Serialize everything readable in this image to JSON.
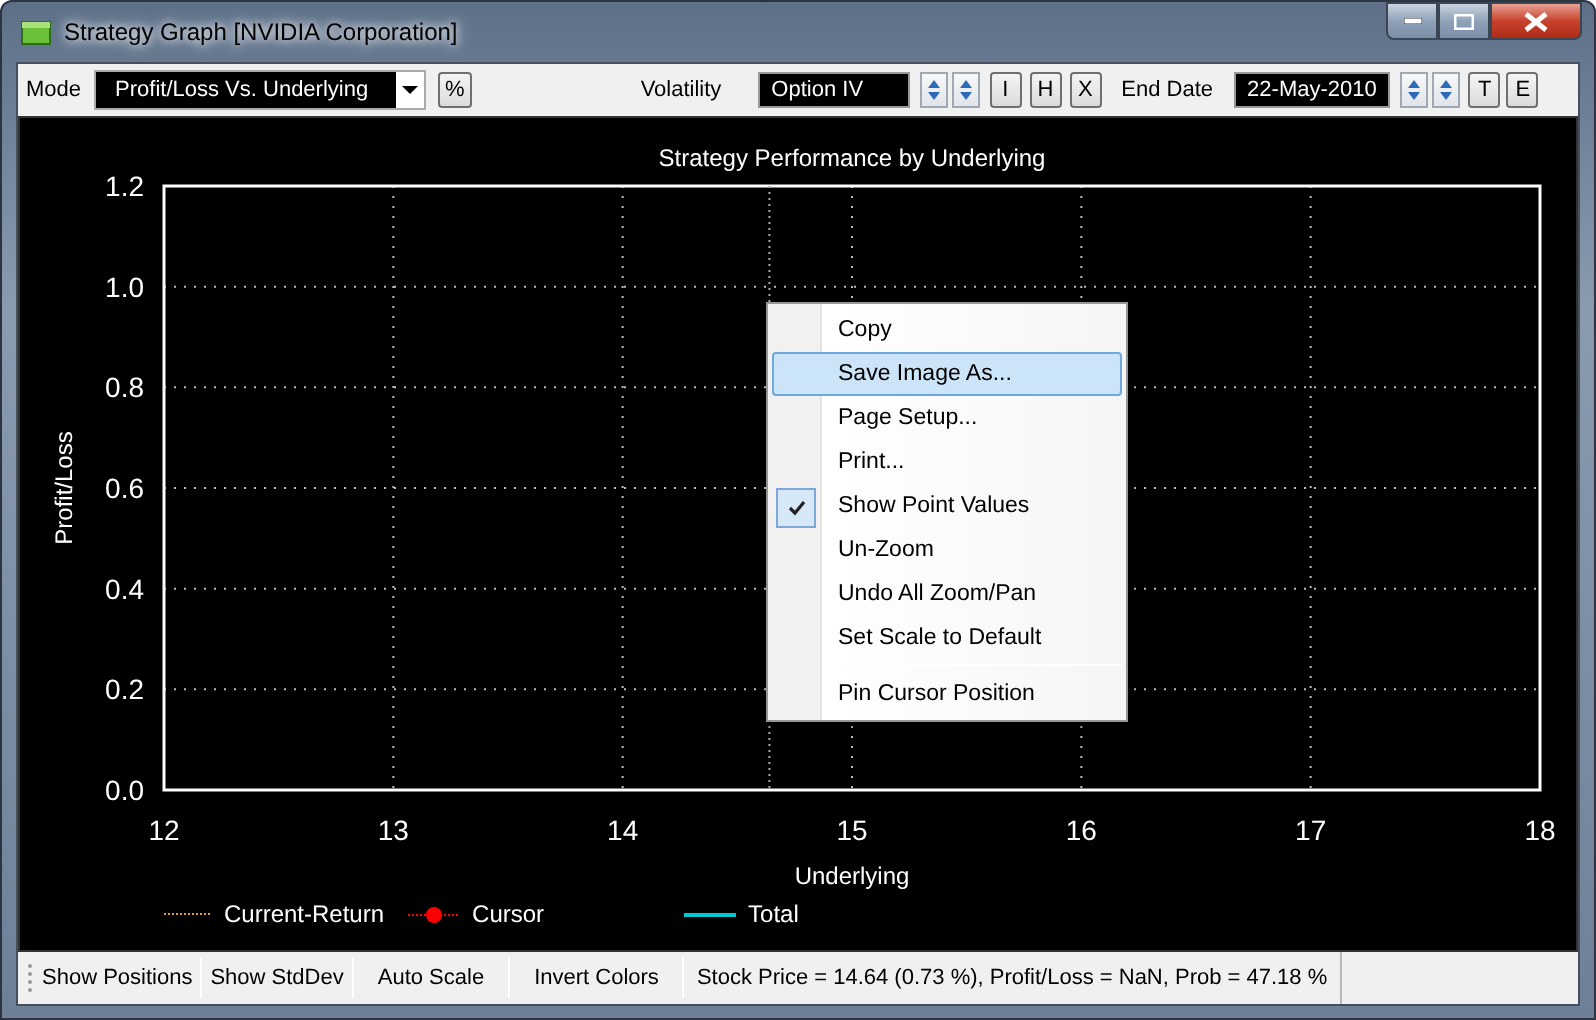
{
  "window": {
    "title": "Strategy Graph [NVIDIA Corporation]"
  },
  "toolbar": {
    "mode_label": "Mode",
    "mode_value": "Profit/Loss Vs. Underlying",
    "percent_button": "%",
    "volatility_label": "Volatility",
    "volatility_value": "Option IV",
    "volatility_buttons": [
      "I",
      "H",
      "X"
    ],
    "end_date_label": "End Date",
    "end_date_value": "22-May-2010",
    "end_date_buttons": [
      "T",
      "E"
    ]
  },
  "chart": {
    "chart_data": {
      "type": "line",
      "title": "Strategy Performance by Underlying",
      "xlabel": "Underlying",
      "ylabel": "Profit/Loss",
      "xlim": [
        12,
        18
      ],
      "ylim": [
        0,
        1.2
      ],
      "xticks": [
        12,
        13,
        14,
        15,
        16,
        17,
        18
      ],
      "yticks": [
        {
          "value": 0,
          "label": "0.0"
        },
        {
          "value": 0.2,
          "label": "0.2"
        },
        {
          "value": 0.4,
          "label": "0.4"
        },
        {
          "value": 0.6,
          "label": "0.6"
        },
        {
          "value": 0.8,
          "label": "0.8"
        },
        {
          "value": 1,
          "label": "1.0"
        },
        {
          "value": 1.2,
          "label": "1.2"
        }
      ],
      "grid": true,
      "ref_lines": [
        {
          "axis": "x",
          "value": 14.64
        }
      ]
    },
    "legend": [
      {
        "label": "Current-Return",
        "kind": "dotted",
        "color": "#d9a030"
      },
      {
        "label": "Cursor",
        "kind": "marker",
        "color": "#ff0000"
      },
      {
        "label": "Total",
        "kind": "solid",
        "color": "#00c8d0"
      }
    ]
  },
  "context_menu": [
    {
      "kind": "item",
      "label": "Copy",
      "selected": false,
      "checked": false
    },
    {
      "kind": "item",
      "label": "Save Image As...",
      "selected": true,
      "checked": false
    },
    {
      "kind": "item",
      "label": "Page Setup...",
      "selected": false,
      "checked": false
    },
    {
      "kind": "item",
      "label": "Print...",
      "selected": false,
      "checked": false
    },
    {
      "kind": "item",
      "label": "Show Point Values",
      "selected": false,
      "checked": true
    },
    {
      "kind": "item",
      "label": "Un-Zoom",
      "selected": false,
      "checked": false
    },
    {
      "kind": "item",
      "label": "Undo All Zoom/Pan",
      "selected": false,
      "checked": false
    },
    {
      "kind": "item",
      "label": "Set Scale to Default",
      "selected": false,
      "checked": false
    },
    {
      "kind": "separator"
    },
    {
      "kind": "item",
      "label": "Pin Cursor Position",
      "selected": false,
      "checked": false
    }
  ],
  "status_bar": {
    "buttons": [
      "Show Positions",
      "Show StdDev",
      "Auto Scale",
      "Invert Colors"
    ],
    "status": "Stock Price = 14.64 (0.73 %), Profit/Loss = NaN, Prob = 47.18 %"
  }
}
